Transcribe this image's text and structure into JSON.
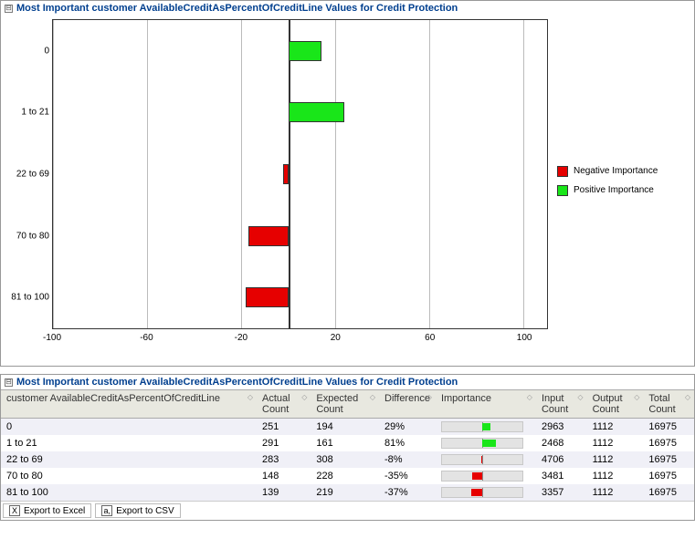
{
  "chart_panel": {
    "collapse_glyph": "⊟",
    "title": "Most Important customer AvailableCreditAsPercentOfCreditLine Values for Credit Protection"
  },
  "chart_data": {
    "type": "bar",
    "orientation": "horizontal",
    "categories": [
      "0",
      "1 to 21",
      "22 to 69",
      "70 to 80",
      "81 to 100"
    ],
    "values": [
      14,
      24,
      -2,
      -17,
      -18
    ],
    "xlabel": "",
    "ylabel": "",
    "xlim": [
      -100,
      110
    ],
    "xticks": [
      -100,
      -60,
      -20,
      20,
      60,
      100
    ],
    "legend": [
      {
        "name": "Negative Importance",
        "color": "#e60000"
      },
      {
        "name": "Positive Importance",
        "color": "#19e619"
      }
    ]
  },
  "table_panel": {
    "collapse_glyph": "⊟",
    "title": "Most Important customer AvailableCreditAsPercentOfCreditLine Values for Credit Protection"
  },
  "table": {
    "columns": [
      "customer AvailableCreditAsPercentOfCreditLine",
      "Actual Count",
      "Expected Count",
      "Difference",
      "Importance",
      "Input Count",
      "Output Count",
      "Total Count"
    ],
    "rows": [
      {
        "cat": "0",
        "actual": 251,
        "expected": 194,
        "diff": "29%",
        "imp": 14,
        "input": 2963,
        "output": 1112,
        "total": 16975
      },
      {
        "cat": "1 to 21",
        "actual": 291,
        "expected": 161,
        "diff": "81%",
        "imp": 24,
        "input": 2468,
        "output": 1112,
        "total": 16975
      },
      {
        "cat": "22 to 69",
        "actual": 283,
        "expected": 308,
        "diff": "-8%",
        "imp": -2,
        "input": 4706,
        "output": 1112,
        "total": 16975
      },
      {
        "cat": "70 to 80",
        "actual": 148,
        "expected": 228,
        "diff": "-35%",
        "imp": -17,
        "input": 3481,
        "output": 1112,
        "total": 16975
      },
      {
        "cat": "81 to 100",
        "actual": 139,
        "expected": 219,
        "diff": "-37%",
        "imp": -18,
        "input": 3357,
        "output": 1112,
        "total": 16975
      }
    ]
  },
  "export": {
    "excel_label": "Export to Excel",
    "csv_label": "Export to CSV"
  }
}
